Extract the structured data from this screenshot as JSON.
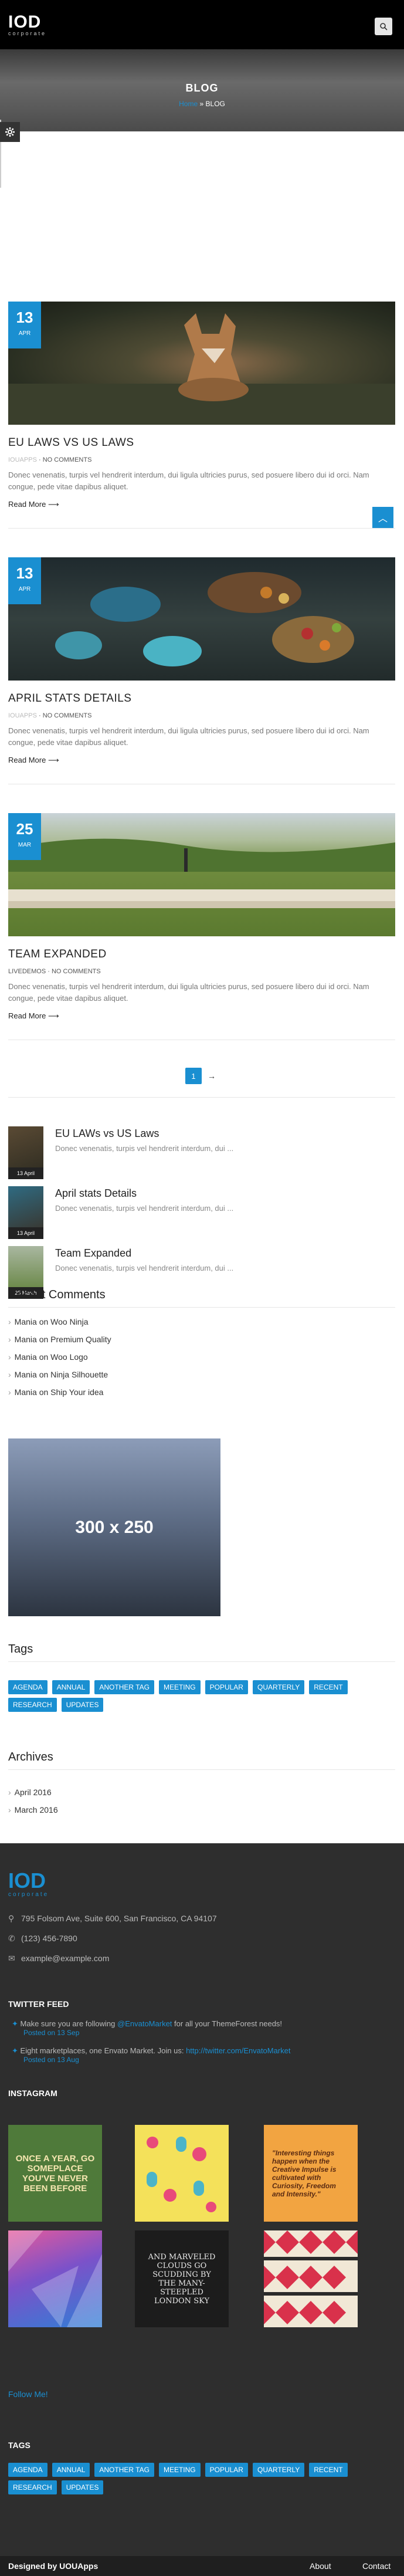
{
  "header": {
    "logo_main": "IOD",
    "logo_sub": "corporate"
  },
  "hero": {
    "title": "BLOG",
    "crumb_home": "Home",
    "crumb_sep": "»",
    "crumb_current": "BLOG"
  },
  "posts": [
    {
      "day": "13",
      "month": "APR",
      "title": "EU LAWS VS US LAWS",
      "author": "IOUAPPS",
      "comments": "NO COMMENTS",
      "excerpt": "Donec venenatis, turpis vel hendrerit interdum, dui ligula ultricies purus, sed posuere libero dui id orci. Nam congue, pede vitae dapibus aliquet.",
      "read_more": "Read More"
    },
    {
      "day": "13",
      "month": "APR",
      "title": "APRIL STATS DETAILS",
      "author": "IOUAPPS",
      "comments": "NO COMMENTS",
      "excerpt": "Donec venenatis, turpis vel hendrerit interdum, dui ligula ultricies purus, sed posuere libero dui id orci. Nam congue, pede vitae dapibus aliquet.",
      "read_more": "Read More"
    },
    {
      "day": "25",
      "month": "MAR",
      "title": "TEAM EXPANDED",
      "author": "LIVEDEMOS",
      "comments": "NO COMMENTS",
      "excerpt": "Donec venenatis, turpis vel hendrerit interdum, dui ligula ultricies purus, sed posuere libero dui id orci. Nam congue, pede vitae dapibus aliquet.",
      "read_more": "Read More"
    }
  ],
  "pagination": {
    "current": "1",
    "next": "→"
  },
  "recent_posts": [
    {
      "title": "EU LAWs vs US Laws",
      "excerpt": "Donec venenatis, turpis vel hendrerit interdum, dui ...",
      "date": "13 April"
    },
    {
      "title": "April stats Details",
      "excerpt": "Donec venenatis, turpis vel hendrerit interdum, dui ...",
      "date": "13 April"
    },
    {
      "title": "Team Expanded",
      "excerpt": "Donec venenatis, turpis vel hendrerit interdum, dui ...",
      "date": "25 March"
    }
  ],
  "recent_comments": {
    "title": "Recent Comments",
    "items": [
      "Mania on Woo Ninja",
      "Mania on Premium Quality",
      "Mania on Woo Logo",
      "Mania on Ninja Silhouette",
      "Mania on Ship Your idea"
    ]
  },
  "ad": {
    "label": "300 x 250"
  },
  "tags_widget": {
    "title": "Tags",
    "tags": [
      "AGENDA",
      "ANNUAL",
      "ANOTHER TAG",
      "MEETING",
      "POPULAR",
      "QUARTERLY",
      "RECENT",
      "RESEARCH",
      "UPDATES"
    ]
  },
  "archives": {
    "title": "Archives",
    "items": [
      "April 2016",
      "March 2016"
    ]
  },
  "footer": {
    "logo_main": "IOD",
    "logo_sub": "corporate",
    "address": "795 Folsom Ave, Suite 600, San Francisco, CA 94107",
    "phone": "(123) 456-7890",
    "email": "example@example.com",
    "twitter_title": "TWITTER FEED",
    "tweets": [
      {
        "pre": "Make sure you are following ",
        "handle": "@EnvatoMarket",
        "post": " for all your ThemeForest needs!",
        "when": "Posted on 13 Sep"
      },
      {
        "pre": "Eight marketplaces, one Envato Market. Join us: ",
        "handle": "http://twitter.com/EnvatoMarket",
        "post": "",
        "when": "Posted on 13 Aug"
      }
    ],
    "instagram_title": "INSTAGRAM",
    "instagram": [
      {
        "text": "ONCE A YEAR, GO SOMEPLACE YOU'VE NEVER BEEN BEFORE"
      },
      {
        "text": ""
      },
      {
        "text": "\"Interesting things happen when the Creative Impulse is cultivated with Curiosity, Freedom and Intensity.\""
      },
      {
        "text": ""
      },
      {
        "text": "AND MARVELED CLOUDS GO SCUDDING BY THE MANY-STEEPLED LONDON SKY"
      },
      {
        "text": ""
      }
    ],
    "follow": "Follow Me!",
    "tags_title": "TAGS",
    "tags": [
      "AGENDA",
      "ANNUAL",
      "ANOTHER TAG",
      "MEETING",
      "POPULAR",
      "QUARTERLY",
      "RECENT",
      "RESEARCH",
      "UPDATES"
    ],
    "credit": "Designed by UOUApps",
    "links": [
      "About",
      "Contact"
    ]
  }
}
